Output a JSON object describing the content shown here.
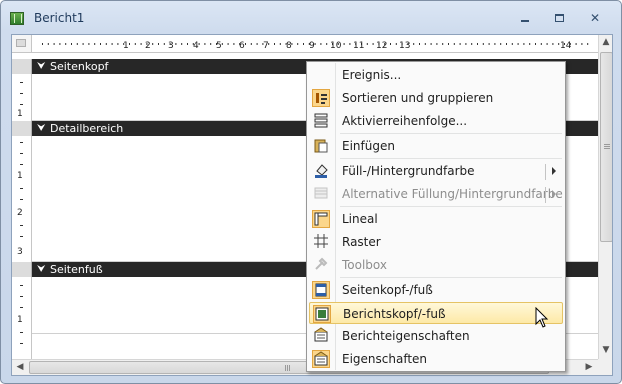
{
  "window": {
    "title": "Bericht1",
    "buttons": {
      "minimize": "minimize",
      "maximize": "maximize",
      "close": "✕"
    }
  },
  "ruler": {
    "marks": [
      "1",
      "2",
      "3",
      "4",
      "5",
      "6",
      "7",
      "8",
      "9",
      "10",
      "11",
      "12",
      "13",
      "14"
    ],
    "vertical_marks": [
      "1",
      "1",
      "2",
      "3",
      "1"
    ]
  },
  "sections": {
    "header": {
      "label": "Seitenkopf",
      "icon": "section-arrow-icon"
    },
    "detail": {
      "label": "Detailbereich",
      "icon": "section-arrow-icon"
    },
    "footer": {
      "label": "Seitenfuß",
      "icon": "section-arrow-icon"
    }
  },
  "context_menu": {
    "items": [
      {
        "label": "Ereignis...",
        "icon": "none",
        "state": "normal"
      },
      {
        "label": "Sortieren und gruppieren",
        "icon": "sort-group-icon",
        "state": "checked"
      },
      {
        "label": "Aktivierreihenfolge...",
        "icon": "tab-order-icon",
        "state": "normal"
      },
      {
        "label": "Einfügen",
        "icon": "paste-icon",
        "state": "normal"
      },
      {
        "label": "Füll-/Hintergrundfarbe",
        "icon": "fill-color-icon",
        "state": "submenu"
      },
      {
        "label": "Alternative Füllung/Hintergrundfarbe",
        "icon": "alternate-fill-icon",
        "state": "disabled-submenu"
      },
      {
        "label": "Lineal",
        "icon": "ruler-icon",
        "state": "checked"
      },
      {
        "label": "Raster",
        "icon": "grid-icon",
        "state": "normal"
      },
      {
        "label": "Toolbox",
        "icon": "toolbox-icon",
        "state": "disabled"
      },
      {
        "label": "Seitenkopf-/fuß",
        "icon": "page-header-footer-icon",
        "state": "checked"
      },
      {
        "label": "Berichtskopf/-fuß",
        "icon": "report-header-footer-icon",
        "state": "hover"
      },
      {
        "label": "Berichteigenschaften",
        "icon": "report-properties-icon",
        "state": "normal"
      },
      {
        "label": "Eigenschaften",
        "icon": "properties-icon",
        "state": "checked"
      }
    ]
  },
  "colors": {
    "section_bar": "#272727",
    "menu_hover": "#fde9a7",
    "checked_icon_bg": "#fbd68b",
    "window_frame": "#cfdcee"
  }
}
